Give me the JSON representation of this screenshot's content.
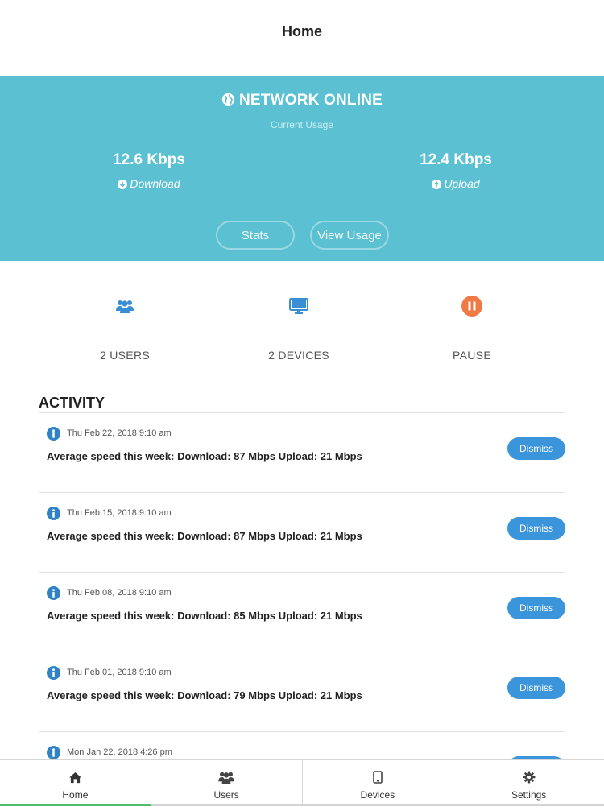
{
  "header": {
    "title": "Home"
  },
  "network": {
    "status": "NETWORK ONLINE",
    "subtitle": "Current Usage",
    "download": {
      "value": "12.6 Kbps",
      "label": "Download"
    },
    "upload": {
      "value": "12.4 Kbps",
      "label": "Upload"
    },
    "buttons": {
      "stats": "Stats",
      "view_usage": "View Usage"
    },
    "color": "#5bc0d2"
  },
  "quick_actions": {
    "users": {
      "label": "2 USERS",
      "icon": "users-icon"
    },
    "devices": {
      "label": "2 DEVICES",
      "icon": "monitor-icon"
    },
    "pause": {
      "label": "PAUSE",
      "icon": "pause-icon"
    }
  },
  "activity": {
    "title": "ACTIVITY",
    "items": [
      {
        "time": "Thu Feb 22, 2018 9:10 am",
        "message": "Average speed this week: Download: 87 Mbps Upload: 21 Mbps",
        "action": "Dismiss"
      },
      {
        "time": "Thu Feb 15, 2018 9:10 am",
        "message": "Average speed this week: Download: 87 Mbps Upload: 21 Mbps",
        "action": "Dismiss"
      },
      {
        "time": "Thu Feb 08, 2018 9:10 am",
        "message": "Average speed this week: Download: 85 Mbps Upload: 21 Mbps",
        "action": "Dismiss"
      },
      {
        "time": "Thu Feb 01, 2018 9:10 am",
        "message": "Average speed this week: Download: 79 Mbps Upload: 21 Mbps",
        "action": "Dismiss"
      },
      {
        "time": "Mon Jan 22, 2018 4:26 pm",
        "message": "",
        "action": ""
      }
    ]
  },
  "tabbar": {
    "tabs": [
      {
        "label": "Home",
        "icon": "home-icon",
        "active": true
      },
      {
        "label": "Users",
        "icon": "users-icon"
      },
      {
        "label": "Devices",
        "icon": "tablet-icon"
      },
      {
        "label": "Settings",
        "icon": "gear-icon"
      }
    ]
  },
  "colors": {
    "accent": "#3a95db",
    "pause": "#ef7a45",
    "active_tab": "#4cbd6a"
  }
}
